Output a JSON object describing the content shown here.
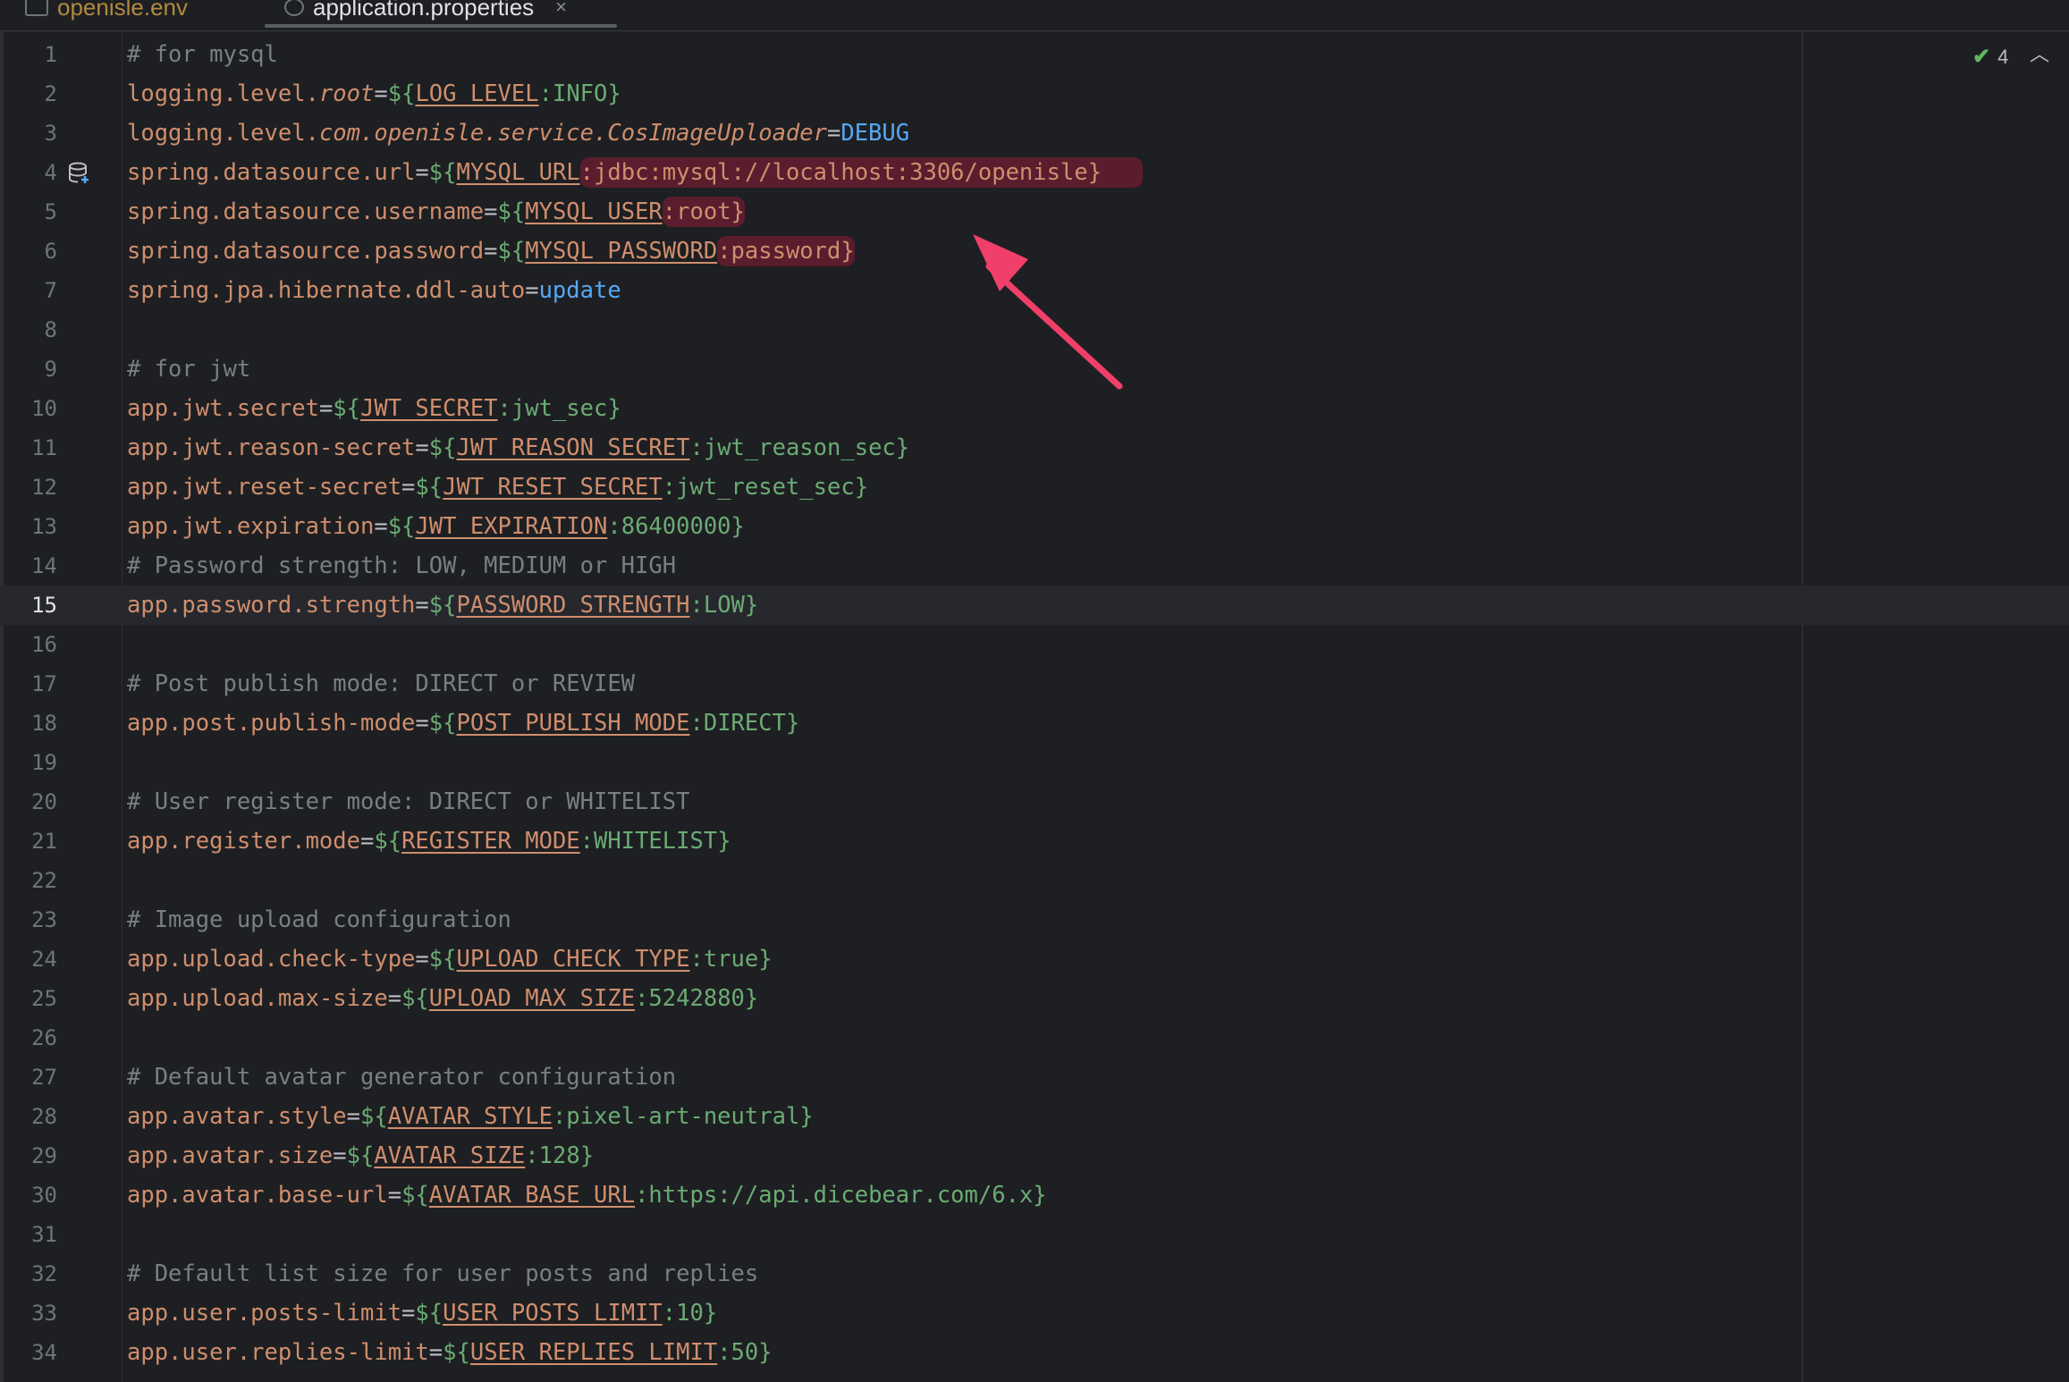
{
  "tabs": [
    {
      "label": "openisle.env",
      "active": false
    },
    {
      "label": "application.properties",
      "active": true
    }
  ],
  "inspection": {
    "count": "4"
  },
  "current_line": 15,
  "lines": [
    {
      "n": "1",
      "segs": [
        [
          "cm",
          "# for mysql"
        ]
      ]
    },
    {
      "n": "2",
      "segs": [
        [
          "k",
          "logging.level."
        ],
        [
          "it",
          "root"
        ],
        [
          "eq",
          "="
        ],
        [
          "br",
          "${"
        ],
        [
          "v",
          "LOG_LEVEL"
        ],
        [
          "c",
          ":INFO"
        ],
        [
          "br",
          "}"
        ]
      ]
    },
    {
      "n": "3",
      "segs": [
        [
          "k",
          "logging.level."
        ],
        [
          "it",
          "com.openisle.service.CosImageUploader"
        ],
        [
          "eq",
          "="
        ],
        [
          "kw",
          "DEBUG"
        ]
      ]
    },
    {
      "n": "4",
      "segs": [
        [
          "k",
          "spring.datasource.url"
        ],
        [
          "eq",
          "="
        ],
        [
          "br",
          "${"
        ],
        [
          "v",
          "MYSQL_URL"
        ],
        [
          "hl",
          ":jdbc:mysql://localhost:3306/openisle}   "
        ]
      ]
    },
    {
      "n": "5",
      "segs": [
        [
          "k",
          "spring.datasource.username"
        ],
        [
          "eq",
          "="
        ],
        [
          "br",
          "${"
        ],
        [
          "v",
          "MYSQL_USER"
        ],
        [
          "hl",
          ":root}"
        ]
      ]
    },
    {
      "n": "6",
      "segs": [
        [
          "k",
          "spring.datasource.password"
        ],
        [
          "eq",
          "="
        ],
        [
          "br",
          "${"
        ],
        [
          "v",
          "MYSQL_PASSWORD"
        ],
        [
          "hl",
          ":password}"
        ]
      ]
    },
    {
      "n": "7",
      "segs": [
        [
          "k",
          "spring.jpa.hibernate.ddl-auto"
        ],
        [
          "eq",
          "="
        ],
        [
          "kw",
          "update"
        ]
      ]
    },
    {
      "n": "8",
      "segs": []
    },
    {
      "n": "9",
      "segs": [
        [
          "cm",
          "# for jwt"
        ]
      ]
    },
    {
      "n": "10",
      "segs": [
        [
          "k",
          "app.jwt.secret"
        ],
        [
          "eq",
          "="
        ],
        [
          "br",
          "${"
        ],
        [
          "v",
          "JWT_SECRET"
        ],
        [
          "c",
          ":jwt_sec"
        ],
        [
          "br",
          "}"
        ]
      ]
    },
    {
      "n": "11",
      "segs": [
        [
          "k",
          "app.jwt.reason-secret"
        ],
        [
          "eq",
          "="
        ],
        [
          "br",
          "${"
        ],
        [
          "v",
          "JWT_REASON_SECRET"
        ],
        [
          "c",
          ":jwt_reason_sec"
        ],
        [
          "br",
          "}"
        ]
      ]
    },
    {
      "n": "12",
      "segs": [
        [
          "k",
          "app.jwt.reset-secret"
        ],
        [
          "eq",
          "="
        ],
        [
          "br",
          "${"
        ],
        [
          "v",
          "JWT_RESET_SECRET"
        ],
        [
          "c",
          ":jwt_reset_sec"
        ],
        [
          "br",
          "}"
        ]
      ]
    },
    {
      "n": "13",
      "segs": [
        [
          "k",
          "app.jwt.expiration"
        ],
        [
          "eq",
          "="
        ],
        [
          "br",
          "${"
        ],
        [
          "v",
          "JWT_EXPIRATION"
        ],
        [
          "c",
          ":86400000"
        ],
        [
          "br",
          "}"
        ]
      ]
    },
    {
      "n": "14",
      "segs": [
        [
          "cm",
          "# Password strength: LOW, MEDIUM or HIGH"
        ]
      ]
    },
    {
      "n": "15",
      "segs": [
        [
          "k",
          "app.password.strength"
        ],
        [
          "eq",
          "="
        ],
        [
          "br",
          "${"
        ],
        [
          "v",
          "PASSWORD_STRENGTH"
        ],
        [
          "c",
          ":LOW"
        ],
        [
          "br",
          "}"
        ]
      ]
    },
    {
      "n": "16",
      "segs": []
    },
    {
      "n": "17",
      "segs": [
        [
          "cm",
          "# Post publish mode: DIRECT or REVIEW"
        ]
      ]
    },
    {
      "n": "18",
      "segs": [
        [
          "k",
          "app.post.publish-mode"
        ],
        [
          "eq",
          "="
        ],
        [
          "br",
          "${"
        ],
        [
          "v",
          "POST_PUBLISH_MODE"
        ],
        [
          "c",
          ":DIRECT"
        ],
        [
          "br",
          "}"
        ]
      ]
    },
    {
      "n": "19",
      "segs": []
    },
    {
      "n": "20",
      "segs": [
        [
          "cm",
          "# User register mode: DIRECT or WHITELIST"
        ]
      ]
    },
    {
      "n": "21",
      "segs": [
        [
          "k",
          "app.register.mode"
        ],
        [
          "eq",
          "="
        ],
        [
          "br",
          "${"
        ],
        [
          "v",
          "REGISTER_MODE"
        ],
        [
          "c",
          ":WHITELIST"
        ],
        [
          "br",
          "}"
        ]
      ]
    },
    {
      "n": "22",
      "segs": []
    },
    {
      "n": "23",
      "segs": [
        [
          "cm",
          "# Image upload configuration"
        ]
      ]
    },
    {
      "n": "24",
      "segs": [
        [
          "k",
          "app.upload.check-type"
        ],
        [
          "eq",
          "="
        ],
        [
          "br",
          "${"
        ],
        [
          "v",
          "UPLOAD_CHECK_TYPE"
        ],
        [
          "c",
          ":true"
        ],
        [
          "br",
          "}"
        ]
      ]
    },
    {
      "n": "25",
      "segs": [
        [
          "k",
          "app.upload.max-size"
        ],
        [
          "eq",
          "="
        ],
        [
          "br",
          "${"
        ],
        [
          "v",
          "UPLOAD_MAX_SIZE"
        ],
        [
          "c",
          ":5242880"
        ],
        [
          "br",
          "}"
        ]
      ]
    },
    {
      "n": "26",
      "segs": []
    },
    {
      "n": "27",
      "segs": [
        [
          "cm",
          "# Default avatar generator configuration"
        ]
      ]
    },
    {
      "n": "28",
      "segs": [
        [
          "k",
          "app.avatar.style"
        ],
        [
          "eq",
          "="
        ],
        [
          "br",
          "${"
        ],
        [
          "v",
          "AVATAR_STYLE"
        ],
        [
          "c",
          ":pixel-art-neutral"
        ],
        [
          "br",
          "}"
        ]
      ]
    },
    {
      "n": "29",
      "segs": [
        [
          "k",
          "app.avatar.size"
        ],
        [
          "eq",
          "="
        ],
        [
          "br",
          "${"
        ],
        [
          "v",
          "AVATAR_SIZE"
        ],
        [
          "c",
          ":128"
        ],
        [
          "br",
          "}"
        ]
      ]
    },
    {
      "n": "30",
      "segs": [
        [
          "k",
          "app.avatar.base-url"
        ],
        [
          "eq",
          "="
        ],
        [
          "br",
          "${"
        ],
        [
          "v",
          "AVATAR_BASE_URL"
        ],
        [
          "c",
          ":https://api.dicebear.com/6.x"
        ],
        [
          "br",
          "}"
        ]
      ]
    },
    {
      "n": "31",
      "segs": []
    },
    {
      "n": "32",
      "segs": [
        [
          "cm",
          "# Default list size for user posts and replies"
        ]
      ]
    },
    {
      "n": "33",
      "segs": [
        [
          "k",
          "app.user.posts-limit"
        ],
        [
          "eq",
          "="
        ],
        [
          "br",
          "${"
        ],
        [
          "v",
          "USER_POSTS_LIMIT"
        ],
        [
          "c",
          ":10"
        ],
        [
          "br",
          "}"
        ]
      ]
    },
    {
      "n": "34",
      "segs": [
        [
          "k",
          "app.user.replies-limit"
        ],
        [
          "eq",
          "="
        ],
        [
          "br",
          "${"
        ],
        [
          "v",
          "USER_REPLIES_LIMIT"
        ],
        [
          "c",
          ":50"
        ],
        [
          "br",
          "}"
        ]
      ]
    }
  ],
  "colors": {
    "background": "#1e1f22",
    "key": "#cf8e6d",
    "value": "#6aab73",
    "keyword": "#56a8f5",
    "comment": "#7a7e85",
    "highlight": "#5a1d2e",
    "arrow": "#f0406a"
  },
  "icons": {
    "gutter_line_4": "database-icon",
    "inspection": "check-icon",
    "collapse": "chevron-up-icon"
  }
}
